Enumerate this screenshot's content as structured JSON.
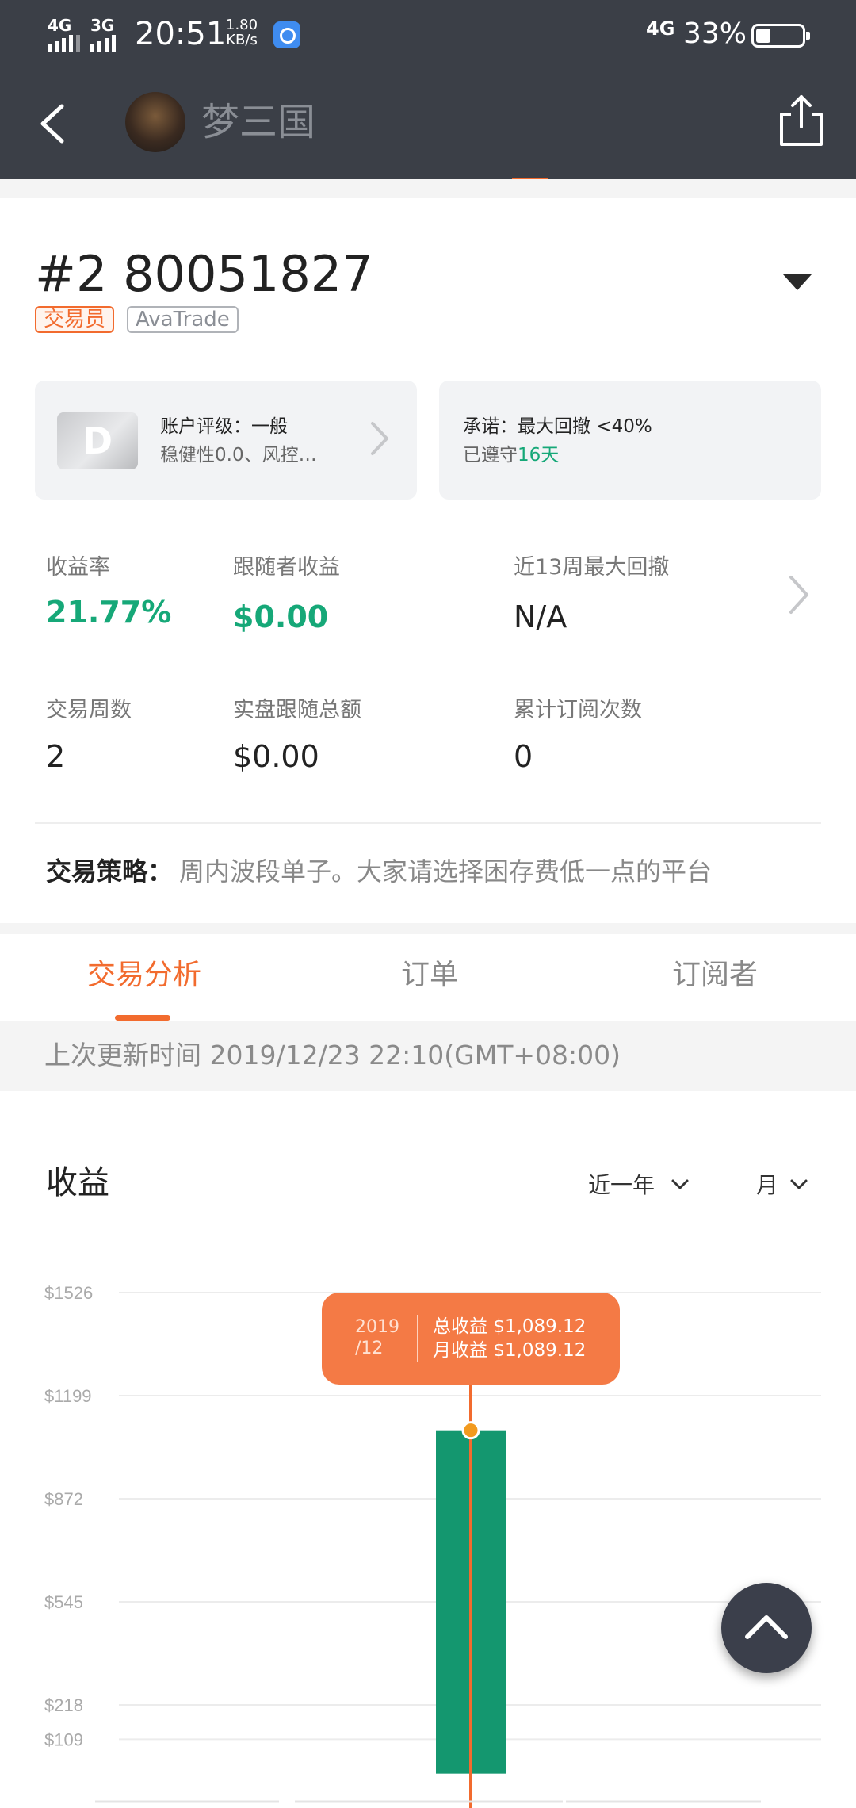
{
  "status_bar": {
    "signal1": "4G",
    "signal2": "3G",
    "time": "20:51",
    "speed_value": "1.80",
    "speed_unit": "KB/s",
    "network": "4G",
    "battery": "33%",
    "battery_level": 0.33
  },
  "nav": {
    "title": "梦三国",
    "back_icon": "chevron-left-icon",
    "share_icon": "share-icon"
  },
  "account": {
    "title": "#2 80051827",
    "tag_role": "交易员",
    "tag_broker": "AvaTrade"
  },
  "rating_card": {
    "badge": "D",
    "line1": "账户评级：一般",
    "line2": "稳健性0.0、风控…"
  },
  "promise_card": {
    "line1": "承诺：最大回撤 <40%",
    "line2_prefix": "已遵守",
    "line2_days": "16天"
  },
  "stats": {
    "return_label": "收益率",
    "return_value": "21.77%",
    "follower_profit_label": "跟随者收益",
    "follower_profit_value": "$0.00",
    "max_drawdown_label": "近13周最大回撤",
    "max_drawdown_value": "N/A",
    "weeks_label": "交易周数",
    "weeks_value": "2",
    "real_follow_label": "实盘跟随总额",
    "real_follow_value": "$0.00",
    "subs_label": "累计订阅次数",
    "subs_value": "0"
  },
  "strategy": {
    "label": "交易策略：",
    "text": "周内波段单子。大家请选择困存费低一点的平台"
  },
  "tabs": [
    {
      "label": "交易分析",
      "active": true
    },
    {
      "label": "订单",
      "active": false
    },
    {
      "label": "订阅者",
      "active": false
    }
  ],
  "update_text": "上次更新时间 2019/12/23 22:10(GMT+08:00)",
  "chart_section": {
    "title": "收益",
    "range_select": "近一年",
    "period_select": "月"
  },
  "tooltip": {
    "date_line1": "2019",
    "date_line2": "/12",
    "total_label": "总收益 $1,089.12",
    "month_label": "月收益 $1,089.12"
  },
  "colors": {
    "accent": "#f26b2e",
    "positive": "#16a878",
    "header": "#3b3f47"
  },
  "chart_data": {
    "type": "bar",
    "title": "收益",
    "categories": [
      "2019/12"
    ],
    "values": [
      1089.12
    ],
    "yticks": [
      "$1526",
      "$1199",
      "$872",
      "$545",
      "$218",
      "$109"
    ],
    "ytick_values": [
      1526,
      1199,
      872,
      545,
      218,
      109
    ],
    "ylim": [
      -109,
      1526
    ],
    "grid": true
  }
}
